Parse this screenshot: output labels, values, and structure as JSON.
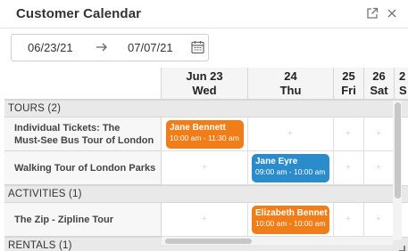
{
  "window": {
    "title": "Customer Calendar"
  },
  "icons": {
    "open_external": "open-external-icon",
    "close": "close-icon",
    "arrow": "arrow-right-icon",
    "calendar": "calendar-icon"
  },
  "date_range": {
    "start": "06/23/21",
    "end": "07/07/21"
  },
  "days": [
    {
      "date": "Jun 23",
      "weekday": "Wed"
    },
    {
      "date": "24",
      "weekday": "Thu"
    },
    {
      "date": "25",
      "weekday": "Fri"
    },
    {
      "date": "26",
      "weekday": "Sat"
    },
    {
      "date": "2",
      "weekday": "S"
    }
  ],
  "groups": [
    {
      "label": "TOURS (2)"
    },
    {
      "label": "ACTIVITIES (1)"
    },
    {
      "label": "RENTALS (1)"
    }
  ],
  "resources": [
    {
      "name": "Individual Tickets: The",
      "name2": "Must-See Bus Tour of London"
    },
    {
      "name": "Walking Tour of London Parks"
    },
    {
      "name": "The Zip - Zipline Tour"
    }
  ],
  "events": [
    {
      "name": "Jane Bennett",
      "time": "10:00 am - 11:30 am",
      "color": "#f07d17"
    },
    {
      "name": "Jane Eyre",
      "time": "09:00 am - 10:00 am",
      "color": "#2b8ccc"
    },
    {
      "name": "Elizabeth Bennet",
      "time": "10:00 am - 10:00 am",
      "color": "#f07d17"
    }
  ],
  "colors": {
    "orange_event": "#f07d17",
    "blue_event": "#2b8ccc",
    "group_bg": "#e9e9e9",
    "header_bg": "#f5f5f5"
  }
}
